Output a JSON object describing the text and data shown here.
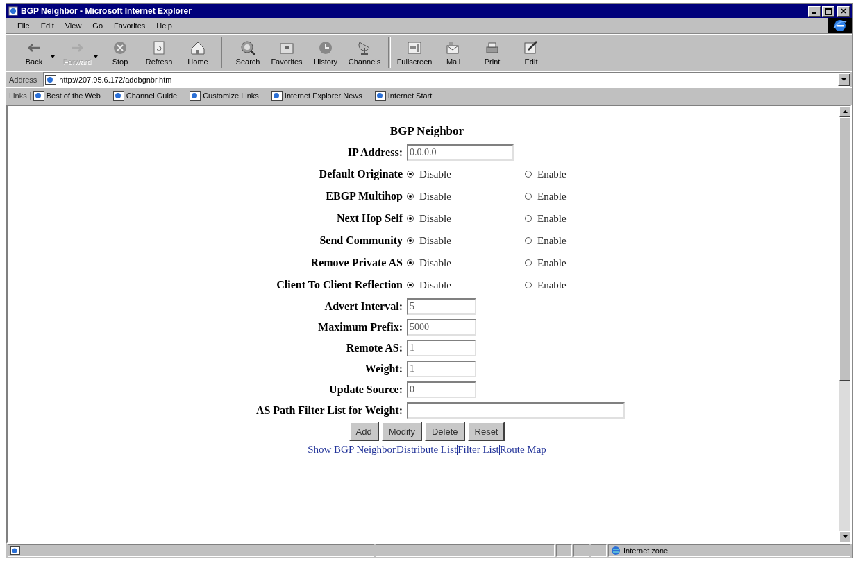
{
  "window": {
    "title": "BGP Neighbor - Microsoft Internet Explorer"
  },
  "menu": [
    "File",
    "Edit",
    "View",
    "Go",
    "Favorites",
    "Help"
  ],
  "toolbar": [
    {
      "buttons": [
        {
          "label": "Back",
          "disabled": false,
          "dropdown": true
        },
        {
          "label": "Forward",
          "disabled": true,
          "dropdown": true
        },
        {
          "label": "Stop",
          "disabled": false,
          "dropdown": false
        },
        {
          "label": "Refresh",
          "disabled": false,
          "dropdown": false
        },
        {
          "label": "Home",
          "disabled": false,
          "dropdown": false
        }
      ]
    },
    {
      "buttons": [
        {
          "label": "Search",
          "disabled": false,
          "dropdown": false
        },
        {
          "label": "Favorites",
          "disabled": false,
          "dropdown": false
        },
        {
          "label": "History",
          "disabled": false,
          "dropdown": false
        },
        {
          "label": "Channels",
          "disabled": false,
          "dropdown": false
        }
      ]
    },
    {
      "buttons": [
        {
          "label": "Fullscreen",
          "disabled": false,
          "dropdown": false
        },
        {
          "label": "Mail",
          "disabled": false,
          "dropdown": false
        },
        {
          "label": "Print",
          "disabled": false,
          "dropdown": false
        },
        {
          "label": "Edit",
          "disabled": false,
          "dropdown": false
        }
      ]
    }
  ],
  "address": {
    "label": "Address",
    "value": "http://207.95.6.172/addbgnbr.htm"
  },
  "links_bar": {
    "label": "Links",
    "items": [
      "Best of the Web",
      "Channel Guide",
      "Customize Links",
      "Internet Explorer News",
      "Internet Start"
    ]
  },
  "page": {
    "title": "BGP Neighbor",
    "fields": [
      {
        "kind": "text",
        "label": "IP Address:",
        "value": "0.0.0.0",
        "wide": true
      },
      {
        "kind": "radio",
        "label": "Default Originate",
        "options": [
          {
            "label": "Disable",
            "selected": true
          },
          {
            "label": "Enable",
            "selected": false
          }
        ]
      },
      {
        "kind": "radio",
        "label": "EBGP Multihop",
        "options": [
          {
            "label": "Disable",
            "selected": true
          },
          {
            "label": "Enable",
            "selected": false
          }
        ]
      },
      {
        "kind": "radio",
        "label": "Next Hop Self",
        "options": [
          {
            "label": "Disable",
            "selected": true
          },
          {
            "label": "Enable",
            "selected": false
          }
        ]
      },
      {
        "kind": "radio",
        "label": "Send Community",
        "options": [
          {
            "label": "Disable",
            "selected": true
          },
          {
            "label": "Enable",
            "selected": false
          }
        ]
      },
      {
        "kind": "radio",
        "label": "Remove Private AS",
        "options": [
          {
            "label": "Disable",
            "selected": true
          },
          {
            "label": "Enable",
            "selected": false
          }
        ]
      },
      {
        "kind": "radio",
        "label": "Client To Client Reflection",
        "options": [
          {
            "label": "Disable",
            "selected": true
          },
          {
            "label": "Enable",
            "selected": false
          }
        ]
      },
      {
        "kind": "text",
        "label": "Advert Interval:",
        "value": "5",
        "wide": false
      },
      {
        "kind": "text",
        "label": "Maximum Prefix:",
        "value": "5000",
        "wide": false
      },
      {
        "kind": "text",
        "label": "Remote AS:",
        "value": "1",
        "wide": false
      },
      {
        "kind": "text",
        "label": "Weight:",
        "value": "1",
        "wide": false
      },
      {
        "kind": "text",
        "label": "Update Source:",
        "value": "0",
        "wide": false
      },
      {
        "kind": "text",
        "label": "AS Path Filter List for Weight:",
        "wide": true,
        "extra_wide": true
      }
    ],
    "buttons": [
      "Add",
      "Modify",
      "Delete",
      "Reset"
    ],
    "links": [
      "Show BGP Neighbor",
      "Distribute List",
      "Filter List",
      "Route Map"
    ]
  },
  "status_bar": {
    "zone": "Internet zone"
  }
}
